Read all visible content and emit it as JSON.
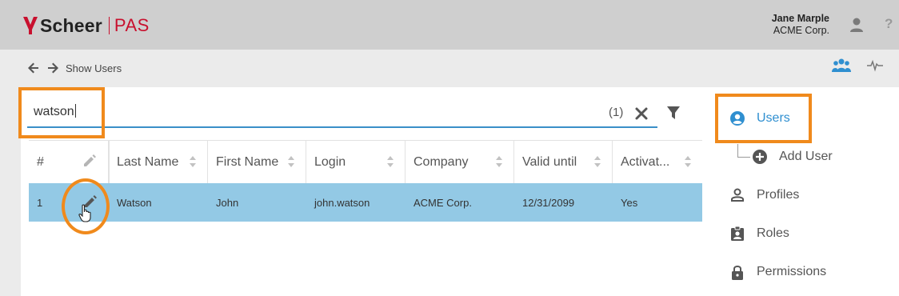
{
  "header": {
    "logo_text": "Scheer",
    "product": "PAS",
    "user_name": "Jane Marple",
    "user_company": "ACME Corp.",
    "help_label": "?"
  },
  "toolbar": {
    "breadcrumb": "Show Users"
  },
  "search": {
    "value": "watson",
    "result_count": "(1)"
  },
  "table": {
    "columns": [
      "#",
      "Last Name",
      "First Name",
      "Login",
      "Company",
      "Valid until",
      "Activat..."
    ],
    "rows": [
      {
        "num": "1",
        "last_name": "Watson",
        "first_name": "John",
        "login": "john.watson",
        "company": "ACME Corp.",
        "valid_until": "12/31/2099",
        "active": "Yes"
      }
    ]
  },
  "nav": {
    "users": "Users",
    "add_user": "Add User",
    "profiles": "Profiles",
    "roles": "Roles",
    "permissions": "Permissions"
  },
  "colors": {
    "accent": "#2f8fd0",
    "highlight": "#f08a1c",
    "brand_red": "#c8102e",
    "row_selected": "#93c9e5"
  },
  "icons": [
    "arrow-left-icon",
    "arrow-right-icon",
    "user-icon",
    "help-icon",
    "group-icon",
    "pulse-icon",
    "clear-icon",
    "filter-icon",
    "pencil-icon",
    "hand-cursor-icon",
    "account-circle-icon",
    "add-circle-icon",
    "person-outline-icon",
    "badge-icon",
    "lock-icon"
  ]
}
